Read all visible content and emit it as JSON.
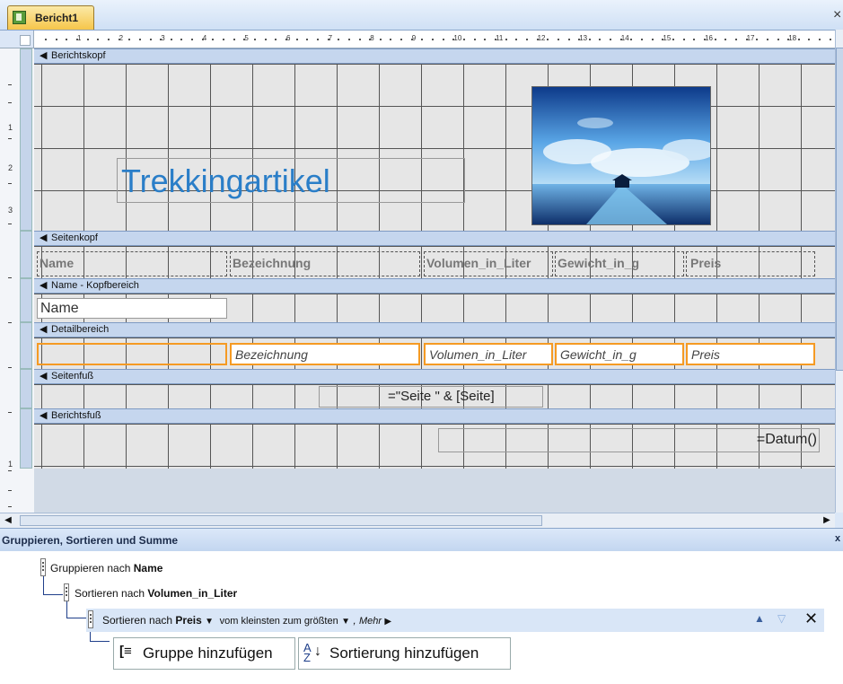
{
  "tab": {
    "label": "Bericht1",
    "close_symbol": "×"
  },
  "ruler": {
    "h_numbers": [
      "1",
      "2",
      "3",
      "4",
      "5",
      "6",
      "7",
      "8",
      "9",
      "10",
      "11",
      "12",
      "13",
      "14",
      "15",
      "16",
      "17",
      "18"
    ],
    "v_numbers": [
      "1",
      "2",
      "3",
      "1"
    ]
  },
  "sections": {
    "report_header": "Berichtskopf",
    "page_header": "Seitenkopf",
    "group_header": "Name - Kopfbereich",
    "detail": "Detailbereich",
    "page_footer": "Seitenfuß",
    "report_footer": "Berichtsfuß"
  },
  "report_header": {
    "title": "Trekkingartikel"
  },
  "page_header_labels": {
    "name": "Name",
    "bezeichnung": "Bezeichnung",
    "volumen": "Volumen_in_Liter",
    "gewicht": "Gewicht_in_g",
    "preis": "Preis"
  },
  "group_header_field": "Name",
  "detail_fields": {
    "bezeichnung": "Bezeichnung",
    "volumen": "Volumen_in_Liter",
    "gewicht": "Gewicht_in_g",
    "preis": "Preis"
  },
  "page_footer_expr": "=\"Seite \" & [Seite]",
  "report_footer_expr": "=Datum()",
  "pane": {
    "title": "Gruppieren, Sortieren und Summe",
    "close_symbol": "x",
    "level1": {
      "prefix": "Gruppieren nach",
      "field": "Name"
    },
    "level2": {
      "prefix": "Sortieren nach",
      "field": "Volumen_in_Liter"
    },
    "level3": {
      "prefix": "Sortieren nach",
      "field": "Preis",
      "order": "vom kleinsten zum größten",
      "more": "Mehr"
    },
    "add_group": "Gruppe hinzufügen",
    "add_sort": "Sortierung hinzufügen"
  },
  "colors": {
    "accent_orange": "#f59a23",
    "title_blue": "#2a7ec8",
    "section_blue": "#c5d6ee"
  }
}
